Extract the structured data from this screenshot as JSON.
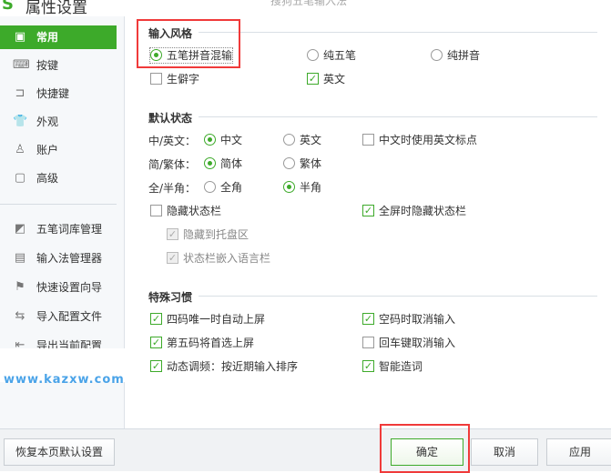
{
  "window": {
    "title": "属性设置",
    "subtitle": "搜狗五笔输入法"
  },
  "sidebar": {
    "items": [
      {
        "label": "常用",
        "icon": "monitor-icon"
      },
      {
        "label": "按键",
        "icon": "keyboard-icon"
      },
      {
        "label": "快捷键",
        "icon": "shortcut-icon"
      },
      {
        "label": "外观",
        "icon": "shirt-icon"
      },
      {
        "label": "账户",
        "icon": "user-icon"
      },
      {
        "label": "高级",
        "icon": "advanced-icon"
      }
    ],
    "tools": [
      {
        "label": "五笔词库管理",
        "icon": "book-icon"
      },
      {
        "label": "输入法管理器",
        "icon": "list-icon"
      },
      {
        "label": "快速设置向导",
        "icon": "flag-icon"
      },
      {
        "label": "导入配置文件",
        "icon": "swap-icon"
      },
      {
        "label": "导出当前配置",
        "icon": "export-icon"
      }
    ]
  },
  "watermark": "www.kazxw.com",
  "input_style": {
    "title": "输入风格",
    "options": [
      "五笔拼音混输",
      "纯五笔",
      "纯拼音"
    ],
    "rare": "生僻字",
    "english": "英文"
  },
  "default_state": {
    "title": "默认状态",
    "cn_en_label": "中/英文：",
    "cn": "中文",
    "en": "英文",
    "cn_en_punct": "中文时使用英文标点",
    "simp_trad_label": "简/繁体：",
    "simp": "简体",
    "trad": "繁体",
    "width_label": "全/半角：",
    "full": "全角",
    "half": "半角",
    "hide_status": "隐藏状态栏",
    "hide_fullscreen": "全屏时隐藏状态栏",
    "hide_tray": "隐藏到托盘区",
    "embed_lang": "状态栏嵌入语言栏"
  },
  "habits": {
    "title": "特殊习惯",
    "items": [
      "四码唯一时自动上屏",
      "空码时取消输入",
      "第五码将首选上屏",
      "回车键取消输入",
      "动态调频：按近期输入排序",
      "智能造词"
    ]
  },
  "buttons": {
    "restore": "恢复本页默认设置",
    "ok": "确定",
    "cancel": "取消",
    "apply": "应用"
  }
}
